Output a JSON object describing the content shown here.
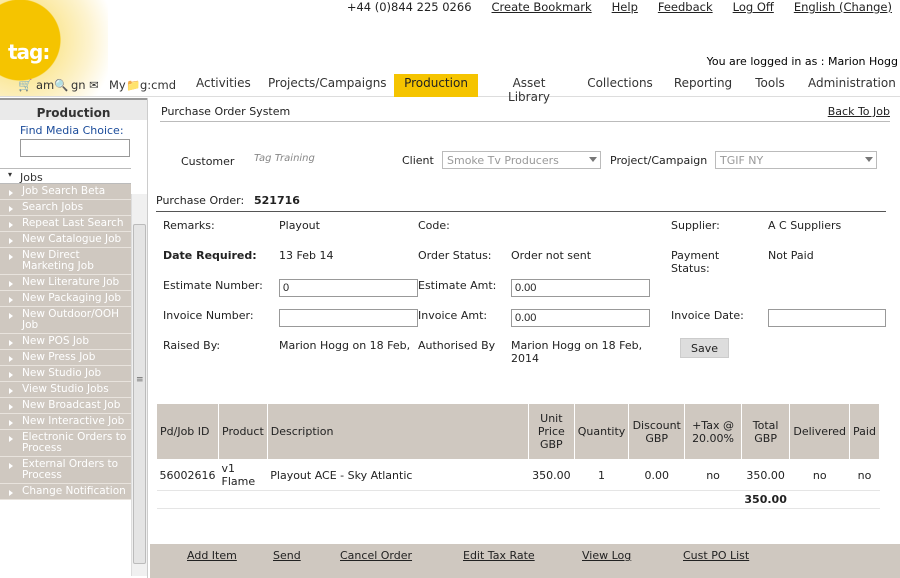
{
  "header": {
    "logo": "tag:",
    "phone": "+44 (0)844 225 0266",
    "links": [
      "Create Bookmark",
      "Help",
      "Feedback",
      "Log Off",
      "English (Change)"
    ],
    "logged_in": "You are logged in as : Marion Hogg"
  },
  "nav": {
    "shortcuts": [
      "am",
      "gn",
      "My",
      "g:cmd"
    ],
    "tabs": [
      "Activities",
      "Projects/Campaigns",
      "Production",
      "Asset Library",
      "Collections",
      "Reporting",
      "Tools",
      "Administration"
    ],
    "active_tab": "Production"
  },
  "sidebar": {
    "heading": "Production",
    "find_label": "Find Media Choice:",
    "jobs_label": "Jobs",
    "items": [
      "Job Search Beta",
      "Search Jobs",
      "Repeat Last Search",
      "New Catalogue Job",
      "New Direct Marketing Job",
      "New Literature Job",
      "New Packaging Job",
      "New Outdoor/OOH Job",
      "New POS Job",
      "New Press Job",
      "New Studio Job",
      "View Studio Jobs",
      "New Broadcast Job",
      "New Interactive Job",
      "Electronic Orders to Process",
      "External Orders to Process",
      "Change Notification"
    ]
  },
  "po": {
    "title": "Purchase Order System",
    "back": "Back To Job",
    "customer_label": "Customer",
    "customer_value": "Tag Training",
    "client_label": "Client",
    "client_value": "Smoke Tv Producers",
    "project_label": "Project/Campaign",
    "project_value": "TGIF NY",
    "po_label": "Purchase Order:",
    "po_number": "521716",
    "remarks_label": "Remarks:",
    "remarks_value": "Playout",
    "code_label": "Code:",
    "supplier_label": "Supplier:",
    "supplier_value": "A C Suppliers",
    "date_label": "Date Required:",
    "date_value": "13 Feb 14",
    "status_label": "Order Status:",
    "status_value": "Order not sent",
    "payment_label": "Payment Status:",
    "payment_value": "Not Paid",
    "est_num_label": "Estimate Number:",
    "est_num_value": "0",
    "est_amt_label": "Estimate Amt:",
    "est_amt_value": "0.00",
    "inv_num_label": "Invoice Number:",
    "inv_amt_label": "Invoice Amt:",
    "inv_amt_value": "0.00",
    "inv_date_label": "Invoice Date:",
    "raised_label": "Raised By:",
    "raised_value": "Marion Hogg on 18 Feb,",
    "auth_label": "Authorised By",
    "auth_value": "Marion Hogg on 18 Feb, 2014",
    "save": "Save"
  },
  "table": {
    "headers": [
      "Pd/Job ID",
      "Product",
      "Description",
      "Unit Price GBP",
      "Quantity",
      "Discount GBP",
      "+Tax @ 20.00%",
      "Total GBP",
      "Delivered",
      "Paid"
    ],
    "rows": [
      [
        "56002616",
        "v1 Flame",
        "Playout ACE - Sky Atlantic",
        "350.00",
        "1",
        "0.00",
        "no",
        "350.00",
        "no",
        "no"
      ]
    ],
    "total": "350.00"
  },
  "actions": [
    "Add Item",
    "Send",
    "Cancel Order",
    "Edit Tax Rate",
    "View Log",
    "Cust PO List"
  ]
}
